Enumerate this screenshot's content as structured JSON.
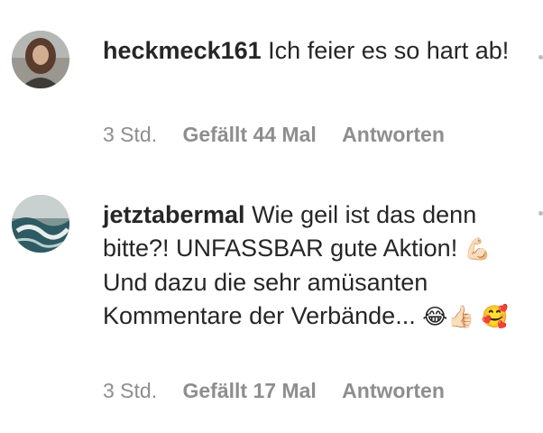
{
  "comments": [
    {
      "username": "heckmeck161",
      "text": "Ich feier es so hart ab!",
      "time": "3 Std.",
      "likes": "Gefällt 44 Mal",
      "reply": "Antworten"
    },
    {
      "username": "jetztabermal",
      "text_part1": "Wie geil ist das denn bitte?! UNFASSBAR gute Aktion!",
      "emoji_muscle": "💪🏻",
      "text_part2": "Und dazu die sehr amüsanten Kommentare der Verbände...",
      "emoji_laugh": "😂",
      "emoji_thumb": "👍🏻",
      "emoji_love": "🥰",
      "time": "3 Std.",
      "likes": "Gefällt 17 Mal",
      "reply": "Antworten"
    }
  ],
  "colors": {
    "text": "#262626",
    "meta": "#8e8e8e"
  }
}
